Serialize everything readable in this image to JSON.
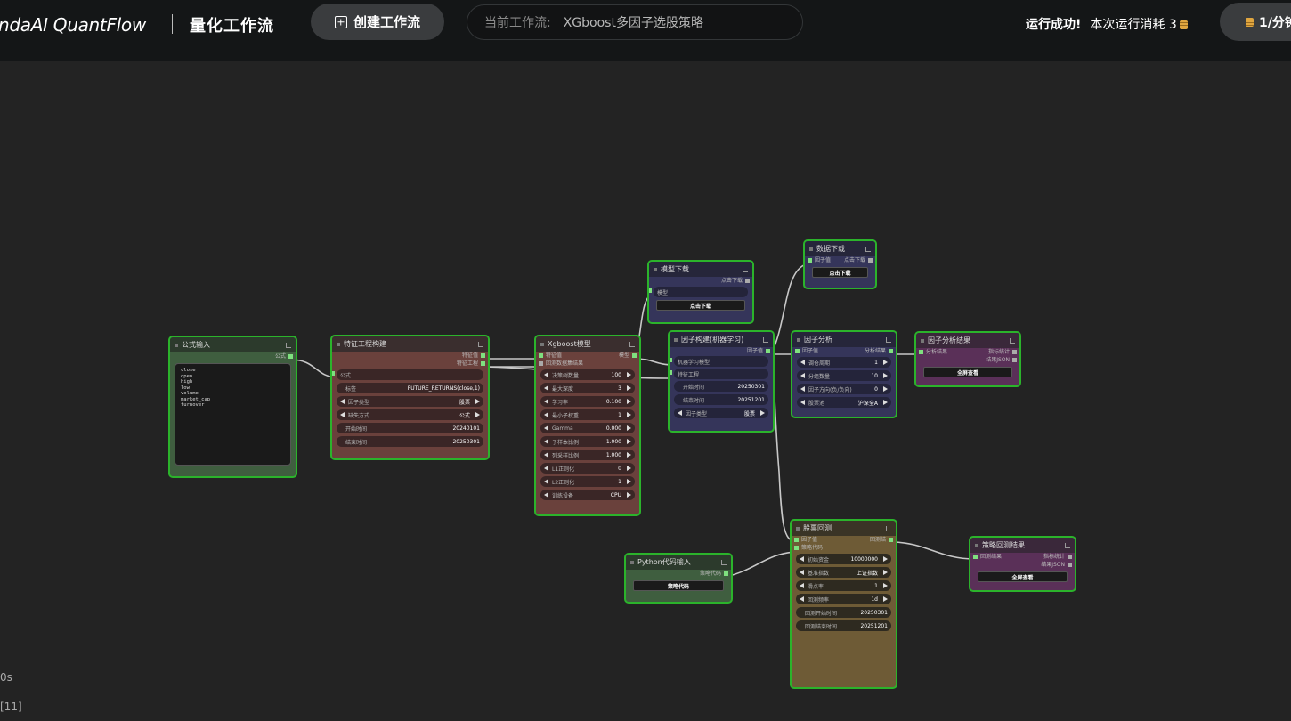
{
  "header": {
    "brand": "ndaAI QuantFlow",
    "subtitle": "量化工作流",
    "create_button": "创建工作流",
    "current_label": "当前工作流:",
    "current_value": "XGboost多因子选股策略",
    "status_success": "运行成功!",
    "status_cost": "本次运行消耗 3",
    "rate": "1/分钟"
  },
  "side": {
    "elapsed": "0s",
    "queue": "[11]"
  },
  "nodes": {
    "formula": {
      "title": "公式输入",
      "out_label": "公式",
      "code": [
        "close",
        "open",
        "high",
        "low",
        "volume",
        "market_cap",
        "turnover"
      ]
    },
    "feature": {
      "title": "特征工程构建",
      "out1": "特征值",
      "out2": "特征工程",
      "in1": "公式",
      "w": [
        {
          "label": "标签",
          "value": "FUTURE_RETURNS(close,1)"
        },
        {
          "label": "因子类型",
          "value": "股票"
        },
        {
          "label": "缺失方式",
          "value": "公式"
        },
        {
          "label": "开始时间",
          "value": "20240101"
        },
        {
          "label": "结束时间",
          "value": "20250301"
        }
      ]
    },
    "xgb": {
      "title": "Xgboost模型",
      "in1": "特征值",
      "in2": "回测数据集结果",
      "out1": "模型",
      "w": [
        {
          "label": "决策树数量",
          "value": "100"
        },
        {
          "label": "最大深度",
          "value": "3"
        },
        {
          "label": "学习率",
          "value": "0.100"
        },
        {
          "label": "最小子权重",
          "value": "1"
        },
        {
          "label": "Gamma",
          "value": "0.000"
        },
        {
          "label": "子样本比例",
          "value": "1.000"
        },
        {
          "label": "列采样比例",
          "value": "1.000"
        },
        {
          "label": "L1正则化",
          "value": "0"
        },
        {
          "label": "L2正则化",
          "value": "1"
        },
        {
          "label": "训练设备",
          "value": "CPU"
        }
      ]
    },
    "model_dl": {
      "title": "模型下载",
      "out1": "点击下载",
      "in1": "模型",
      "btn": "点击下载"
    },
    "factor_build": {
      "title": "因子构建(机器学习)",
      "out1": "因子值",
      "in1": "机器学习模型",
      "in2": "特征工程",
      "w": [
        {
          "label": "开始时间",
          "value": "20250301"
        },
        {
          "label": "结束时间",
          "value": "20251201"
        },
        {
          "label": "因子类型",
          "value": "股票"
        }
      ]
    },
    "data_dl": {
      "title": "数据下载",
      "in1": "因子值",
      "out1": "点击下载",
      "btn": "点击下载"
    },
    "factor_anal": {
      "title": "因子分析",
      "in1": "因子值",
      "out1": "分析结果",
      "w": [
        {
          "label": "调仓周期",
          "value": "1"
        },
        {
          "label": "分组数量",
          "value": "10"
        },
        {
          "label": "因子方向(负/负向)",
          "value": "0"
        },
        {
          "label": "股票池",
          "value": "沪深全A"
        }
      ]
    },
    "factor_result": {
      "title": "因子分析结果",
      "in1": "分析结果",
      "out1": "指标统计",
      "out2": "结果JSON",
      "btn": "全屏查看"
    },
    "python": {
      "title": "Python代码输入",
      "out1": "策略代码",
      "btn": "策略代码"
    },
    "backtest": {
      "title": "股票回测",
      "in1": "因子值",
      "in2": "策略代码",
      "out1": "回测结",
      "w": [
        {
          "label": "初始资金",
          "value": "10000000",
          "arrows": true
        },
        {
          "label": "基准指数",
          "value": "上证指数",
          "arrows": true
        },
        {
          "label": "滑点率",
          "value": "1",
          "arrows": true
        },
        {
          "label": "回测频率",
          "value": "1d",
          "arrows": true
        },
        {
          "label": "回测开始时间",
          "value": "20250301",
          "arrows": false
        },
        {
          "label": "回测结束时间",
          "value": "20251201",
          "arrows": false
        }
      ]
    },
    "strategy_result": {
      "title": "策略回测结果",
      "in1": "回测结果",
      "out1": "指标统计",
      "out2": "结果JSON",
      "btn": "全屏查看"
    }
  }
}
